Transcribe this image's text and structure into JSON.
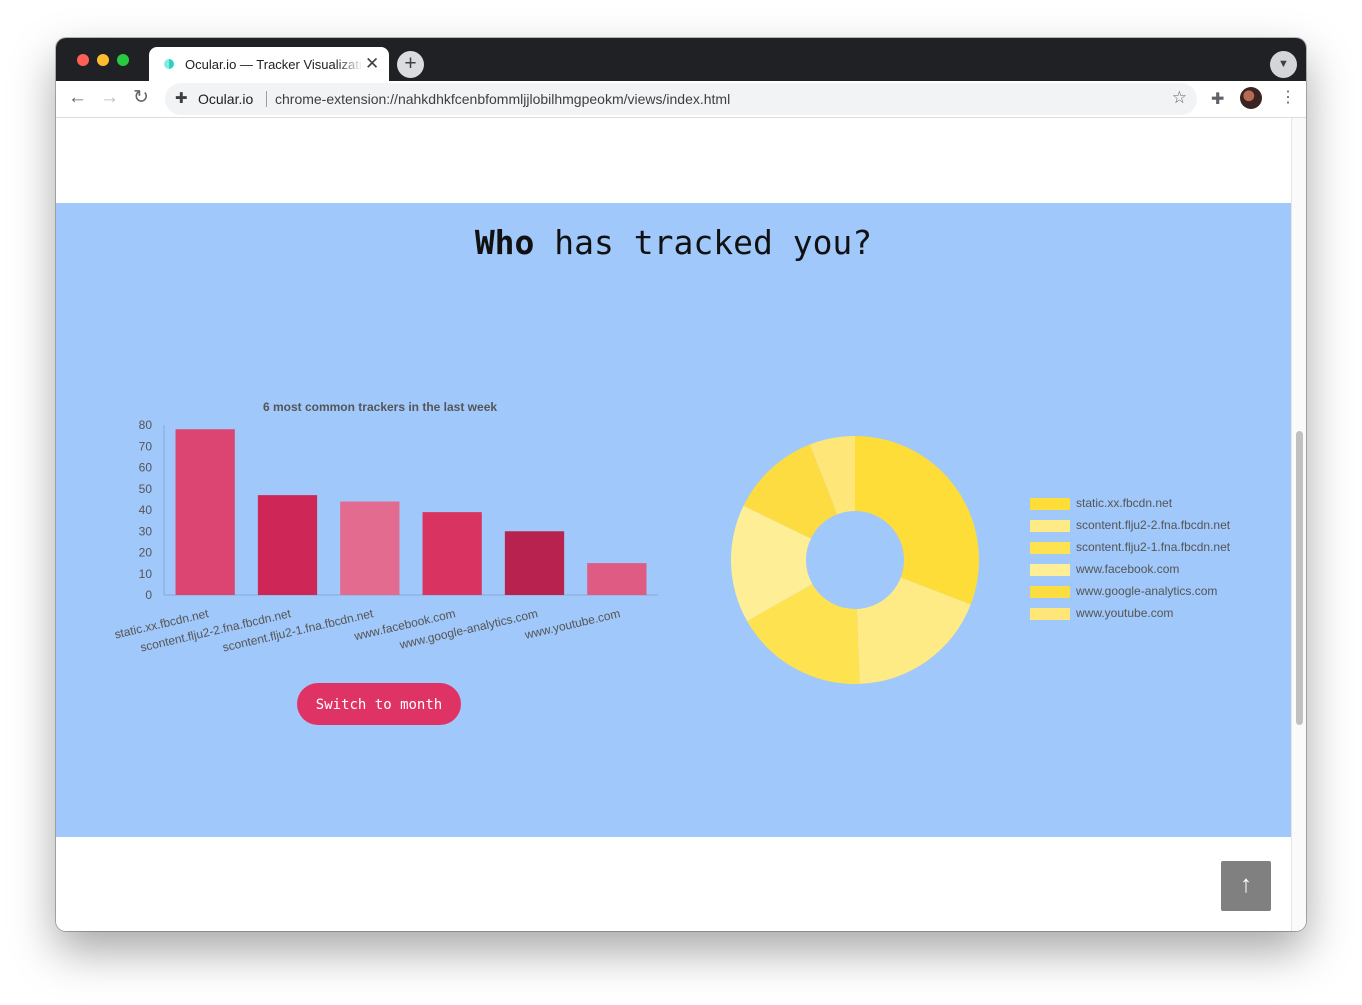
{
  "browser": {
    "tab_title": "Ocular.io — Tracker Visualization",
    "omnibox_host": "Ocular.io",
    "omnibox_url": "chrome-extension://nahkdhkfcenbfommljjlobilhmgpeokm/views/index.html",
    "icons": {
      "back": "back-arrow-icon",
      "forward": "forward-arrow-icon",
      "reload": "reload-icon",
      "extension": "puzzle-icon",
      "bookmark": "star-icon",
      "menu": "kebab-menu-icon",
      "close_tab": "close-icon",
      "new_tab": "plus-icon"
    }
  },
  "page": {
    "heading_bold": "Who",
    "heading_rest": " has tracked you?",
    "switch_button": "Switch to month",
    "back_to_top_icon": "arrow-up-icon",
    "section_background": "#a0c8fa",
    "accent": "#df3366"
  },
  "chart_data": [
    {
      "type": "bar",
      "title": "6 most common trackers in the last week",
      "categories": [
        "static.xx.fbcdn.net",
        "scontent.flju2-2.fna.fbcdn.net",
        "scontent.flju2-1.fna.fbcdn.net",
        "www.facebook.com",
        "www.google-analytics.com",
        "www.youtube.com"
      ],
      "values": [
        78,
        47,
        44,
        39,
        30,
        15
      ],
      "colors": [
        "#dc4572",
        "#cf2658",
        "#e36b90",
        "#d93361",
        "#b7234e",
        "#e05b84"
      ],
      "ylim": [
        0,
        80
      ],
      "yticks": [
        0,
        10,
        20,
        30,
        40,
        50,
        60,
        70,
        80
      ],
      "grid": false
    },
    {
      "type": "pie",
      "donut": true,
      "labels": [
        "static.xx.fbcdn.net",
        "scontent.flju2-2.fna.fbcdn.net",
        "scontent.flju2-1.fna.fbcdn.net",
        "www.facebook.com",
        "www.google-analytics.com",
        "www.youtube.com"
      ],
      "values": [
        78,
        47,
        44,
        39,
        30,
        15
      ],
      "colors": [
        "#fedd39",
        "#feeb86",
        "#fee24f",
        "#feee96",
        "#fddc42",
        "#fee678"
      ],
      "legend_position": "right"
    }
  ]
}
